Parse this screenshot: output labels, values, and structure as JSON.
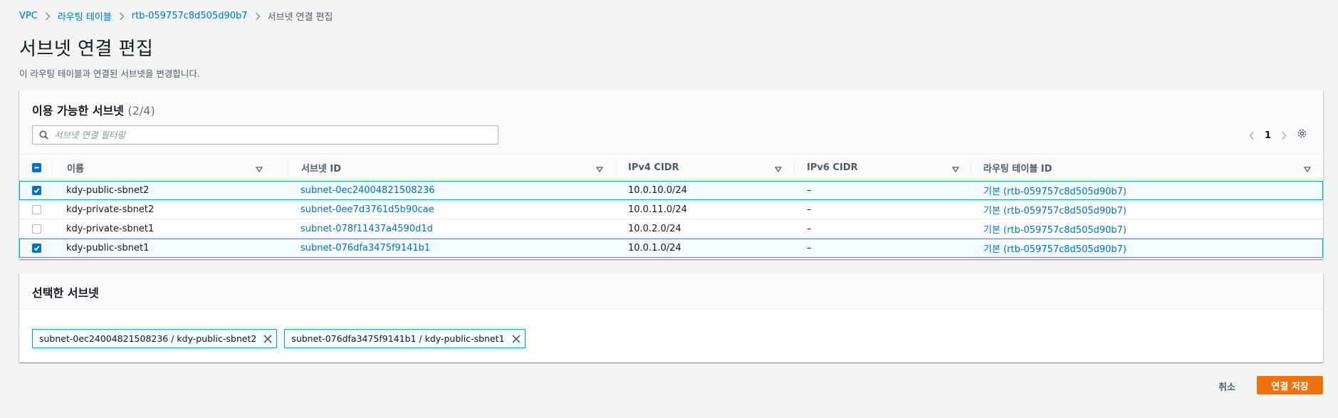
{
  "breadcrumb": {
    "items": [
      "VPC",
      "라우팅 테이블",
      "rtb-059757c8d505d90b7",
      "서브넷 연결 편집"
    ]
  },
  "page": {
    "title": "서브넷 연결 편집",
    "description": "이 라우팅 테이블과 연결된 서브넷을 변경합니다."
  },
  "available": {
    "title": "이용 가능한 서브넷",
    "count": "(2/4)",
    "filter_placeholder": "서브넷 연결 필터링",
    "page": "1",
    "columns": [
      "이름",
      "서브넷 ID",
      "IPv4 CIDR",
      "IPv6 CIDR",
      "라우팅 테이블 ID"
    ],
    "rows": [
      {
        "checked": true,
        "name": "kdy-public-sbnet2",
        "subnet_id": "subnet-0ec24004821508236",
        "ipv4": "10.0.10.0/24",
        "ipv6": "–",
        "route_table": "기본 (rtb-059757c8d505d90b7)"
      },
      {
        "checked": false,
        "name": "kdy-private-sbnet2",
        "subnet_id": "subnet-0ee7d3761d5b90cae",
        "ipv4": "10.0.11.0/24",
        "ipv6": "–",
        "route_table": "기본 (rtb-059757c8d505d90b7)"
      },
      {
        "checked": false,
        "name": "kdy-private-sbnet1",
        "subnet_id": "subnet-078f11437a4590d1d",
        "ipv4": "10.0.2.0/24",
        "ipv6": "–",
        "route_table": "기본 (rtb-059757c8d505d90b7)"
      },
      {
        "checked": true,
        "name": "kdy-public-sbnet1",
        "subnet_id": "subnet-076dfa3475f9141b1",
        "ipv4": "10.0.1.0/24",
        "ipv6": "–",
        "route_table": "기본 (rtb-059757c8d505d90b7)"
      }
    ]
  },
  "selected": {
    "title": "선택한 서브넷",
    "tokens": [
      "subnet-0ec24004821508236 / kdy-public-sbnet2",
      "subnet-076dfa3475f9141b1 / kdy-public-sbnet1"
    ]
  },
  "footer": {
    "cancel_label": "취소",
    "save_label": "연결 저장"
  },
  "colors": {
    "link": "#0073bb",
    "primary": "#ec7211",
    "selection_border": "#00a1c9",
    "selection_bg": "#f1faff"
  },
  "icons": [
    "chevron-right-icon",
    "search-icon",
    "chevron-left-icon",
    "gear-icon",
    "sort-down-icon",
    "close-icon",
    "checkmark-icon"
  ]
}
